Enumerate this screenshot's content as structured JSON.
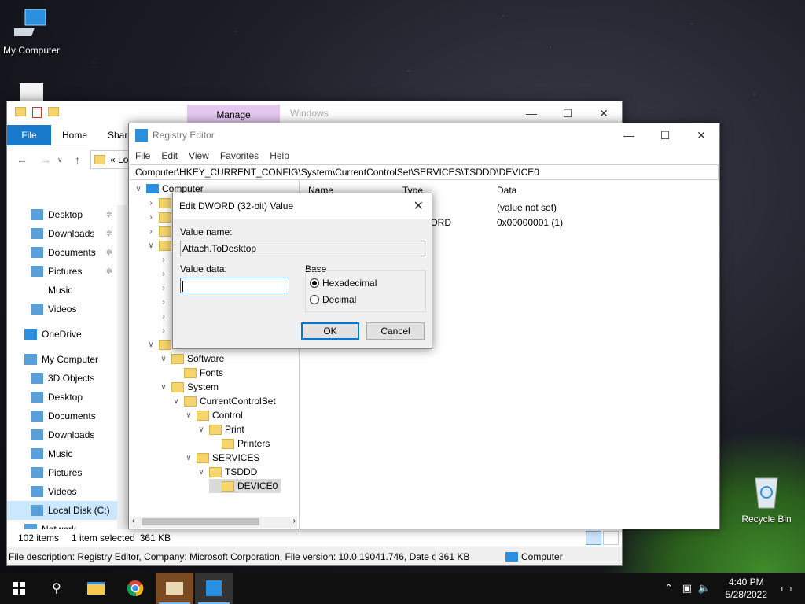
{
  "desktop": {
    "icons": [
      {
        "label": "My Computer"
      },
      {
        "label": "Recycle Bin"
      }
    ]
  },
  "explorer": {
    "manage_tab": "Manage",
    "window_title_fragment": "Windows",
    "ribbon": {
      "file": "File",
      "home": "Home",
      "share": "Share"
    },
    "address_fragment": "Lo",
    "nav_items": [
      {
        "label": "Desktop",
        "pinned": true
      },
      {
        "label": "Downloads",
        "pinned": true
      },
      {
        "label": "Documents",
        "pinned": true
      },
      {
        "label": "Pictures",
        "pinned": true
      },
      {
        "label": "Music",
        "pinned": false
      },
      {
        "label": "Videos",
        "pinned": false
      },
      {
        "label": "OneDrive",
        "pinned": false
      },
      {
        "label": "My Computer",
        "pinned": false
      },
      {
        "label": "3D Objects",
        "pinned": false
      },
      {
        "label": "Desktop",
        "pinned": false
      },
      {
        "label": "Documents",
        "pinned": false
      },
      {
        "label": "Downloads",
        "pinned": false
      },
      {
        "label": "Music",
        "pinned": false
      },
      {
        "label": "Pictures",
        "pinned": false
      },
      {
        "label": "Videos",
        "pinned": false
      },
      {
        "label": "Local Disk (C:)",
        "pinned": false
      },
      {
        "label": "Network",
        "pinned": false
      }
    ],
    "status": {
      "items": "102 items",
      "selected": "1 item selected",
      "size": "361 KB"
    },
    "description": "File description: Registry Editor, Company: Microsoft Corporation, File version: 10.0.19041.746, Date crea",
    "desc_size": "361 KB",
    "desc_location": "Computer"
  },
  "regedit": {
    "title": "Registry Editor",
    "menu": [
      "File",
      "Edit",
      "View",
      "Favorites",
      "Help"
    ],
    "path": "Computer\\HKEY_CURRENT_CONFIG\\System\\CurrentControlSet\\SERVICES\\TSDDD\\DEVICE0",
    "tree": {
      "root": "Computer",
      "software": "Software",
      "fonts": "Fonts",
      "system": "System",
      "ccs": "CurrentControlSet",
      "control": "Control",
      "print": "Print",
      "printers": "Printers",
      "services": "SERVICES",
      "tsddd": "TSDDD",
      "device0": "DEVICE0"
    },
    "columns": {
      "name": "Name",
      "type": "Type",
      "data": "Data"
    },
    "rows": [
      {
        "type_frag": "Z",
        "data": "(value not set)"
      },
      {
        "type_frag": "WORD",
        "data": "0x00000001 (1)"
      }
    ]
  },
  "dialog": {
    "title": "Edit DWORD (32-bit) Value",
    "value_name_label": "Value name:",
    "value_name": "Attach.ToDesktop",
    "value_data_label": "Value data:",
    "value_data": "",
    "base_label": "Base",
    "hex_label": "Hexadecimal",
    "dec_label": "Decimal",
    "selected_base": "Hexadecimal",
    "ok": "OK",
    "cancel": "Cancel"
  },
  "taskbar": {
    "time": "4:40 PM",
    "date": "5/28/2022"
  },
  "colors": {
    "accent": "#0078d7",
    "manage_tab": "#e4c8f0",
    "folder": "#f5d66e"
  }
}
